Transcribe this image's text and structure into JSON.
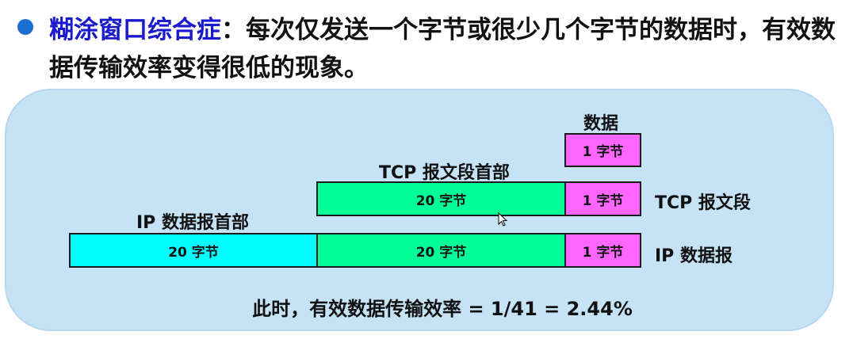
{
  "headline": {
    "term": "糊涂窗口综合症",
    "colon": "：",
    "description": "每次仅发送一个字节或很少几个字节的数据时，有效数据传输效率变得很低的现象。"
  },
  "diagram": {
    "data_label": "数据",
    "data_box": "1 字节",
    "tcp_header_label": "TCP 报文段首部",
    "tcp_header_box": "20 字节",
    "tcp_data_box": "1 字节",
    "tcp_segment_label": "TCP 报文段",
    "ip_header_label": "IP 数据报首部",
    "ip_header_box": "20 字节",
    "ip_tcp_header_box": "20 字节",
    "ip_data_box": "1 字节",
    "ip_datagram_label": "IP 数据报"
  },
  "formula": "此时，有效数据传输效率 = 1/41 = 2.44%",
  "colors": {
    "term": "#1a1acc",
    "panel": "#c6e3f6",
    "ip_header": "#00ffff",
    "tcp_header": "#00ff99",
    "data": "#ff66ff"
  }
}
